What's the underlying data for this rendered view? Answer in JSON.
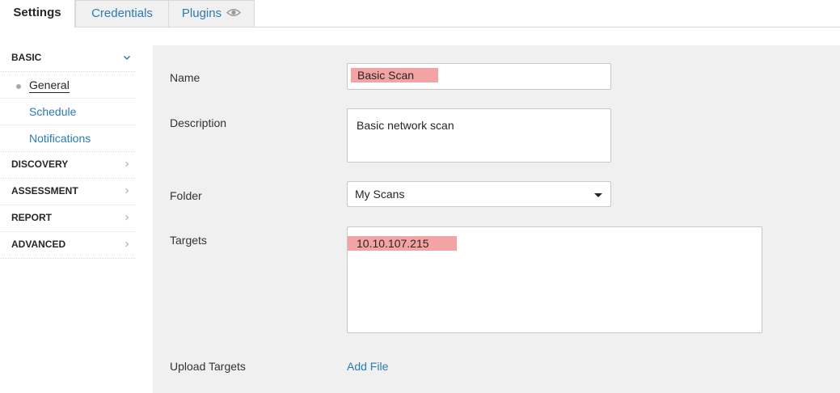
{
  "tabs": [
    {
      "label": "Settings"
    },
    {
      "label": "Credentials"
    },
    {
      "label": "Plugins"
    }
  ],
  "sidebar": {
    "basic": {
      "label": "BASIC",
      "icon": "chevron-down-icon",
      "items": [
        {
          "label": "General"
        },
        {
          "label": "Schedule"
        },
        {
          "label": "Notifications"
        }
      ]
    },
    "sections": [
      {
        "label": "DISCOVERY"
      },
      {
        "label": "ASSESSMENT"
      },
      {
        "label": "REPORT"
      },
      {
        "label": "ADVANCED"
      }
    ]
  },
  "form": {
    "name": {
      "label": "Name",
      "value": "Basic Scan"
    },
    "description": {
      "label": "Description",
      "value": "Basic network scan"
    },
    "folder": {
      "label": "Folder",
      "value": "My Scans"
    },
    "targets": {
      "label": "Targets",
      "value": "10.10.107.215"
    },
    "upload": {
      "label": "Upload Targets",
      "link": "Add File"
    }
  },
  "colors": {
    "accent": "#2a7bb3",
    "highlight": "#f3a3a3",
    "panel": "#f0f0f0"
  }
}
